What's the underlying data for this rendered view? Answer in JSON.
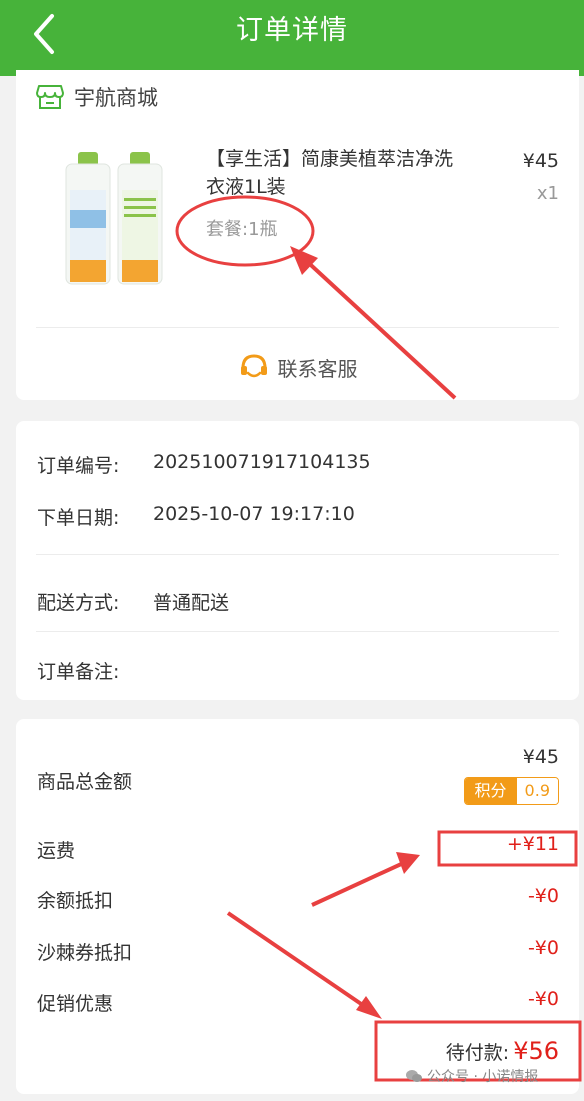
{
  "header": {
    "title": "订单详情"
  },
  "store": {
    "name": "宇航商城"
  },
  "product": {
    "title": "【享生活】简康美植萃洁净洗衣液1L装",
    "spec": "套餐:1瓶",
    "price": "¥45",
    "quantity": "x1"
  },
  "service": {
    "label": "联系客服"
  },
  "order_info": {
    "order_no_label": "订单编号:",
    "order_no": "202510071917104135",
    "date_label": "下单日期:",
    "date": "2025-10-07 19:17:10",
    "delivery_label": "配送方式:",
    "delivery": "普通配送",
    "remark_label": "订单备注:"
  },
  "summary": {
    "total_label": "商品总金额",
    "total": "¥45",
    "points_label": "积分",
    "points_value": "0.9",
    "shipping_label": "运费",
    "shipping": "+¥11",
    "balance_label": "余额抵扣",
    "balance": "-¥0",
    "coupon_label": "沙棘券抵扣",
    "coupon": "-¥0",
    "promo_label": "促销优惠",
    "promo": "-¥0",
    "pay_label": "待付款:",
    "pay_amount": "¥56"
  },
  "watermark": {
    "text": "公众号 · 小诺情报"
  },
  "colors": {
    "brand_green": "#47b33a",
    "price_red": "#e0201a",
    "points_orange": "#f29b18",
    "annotation_red": "#e84040"
  }
}
